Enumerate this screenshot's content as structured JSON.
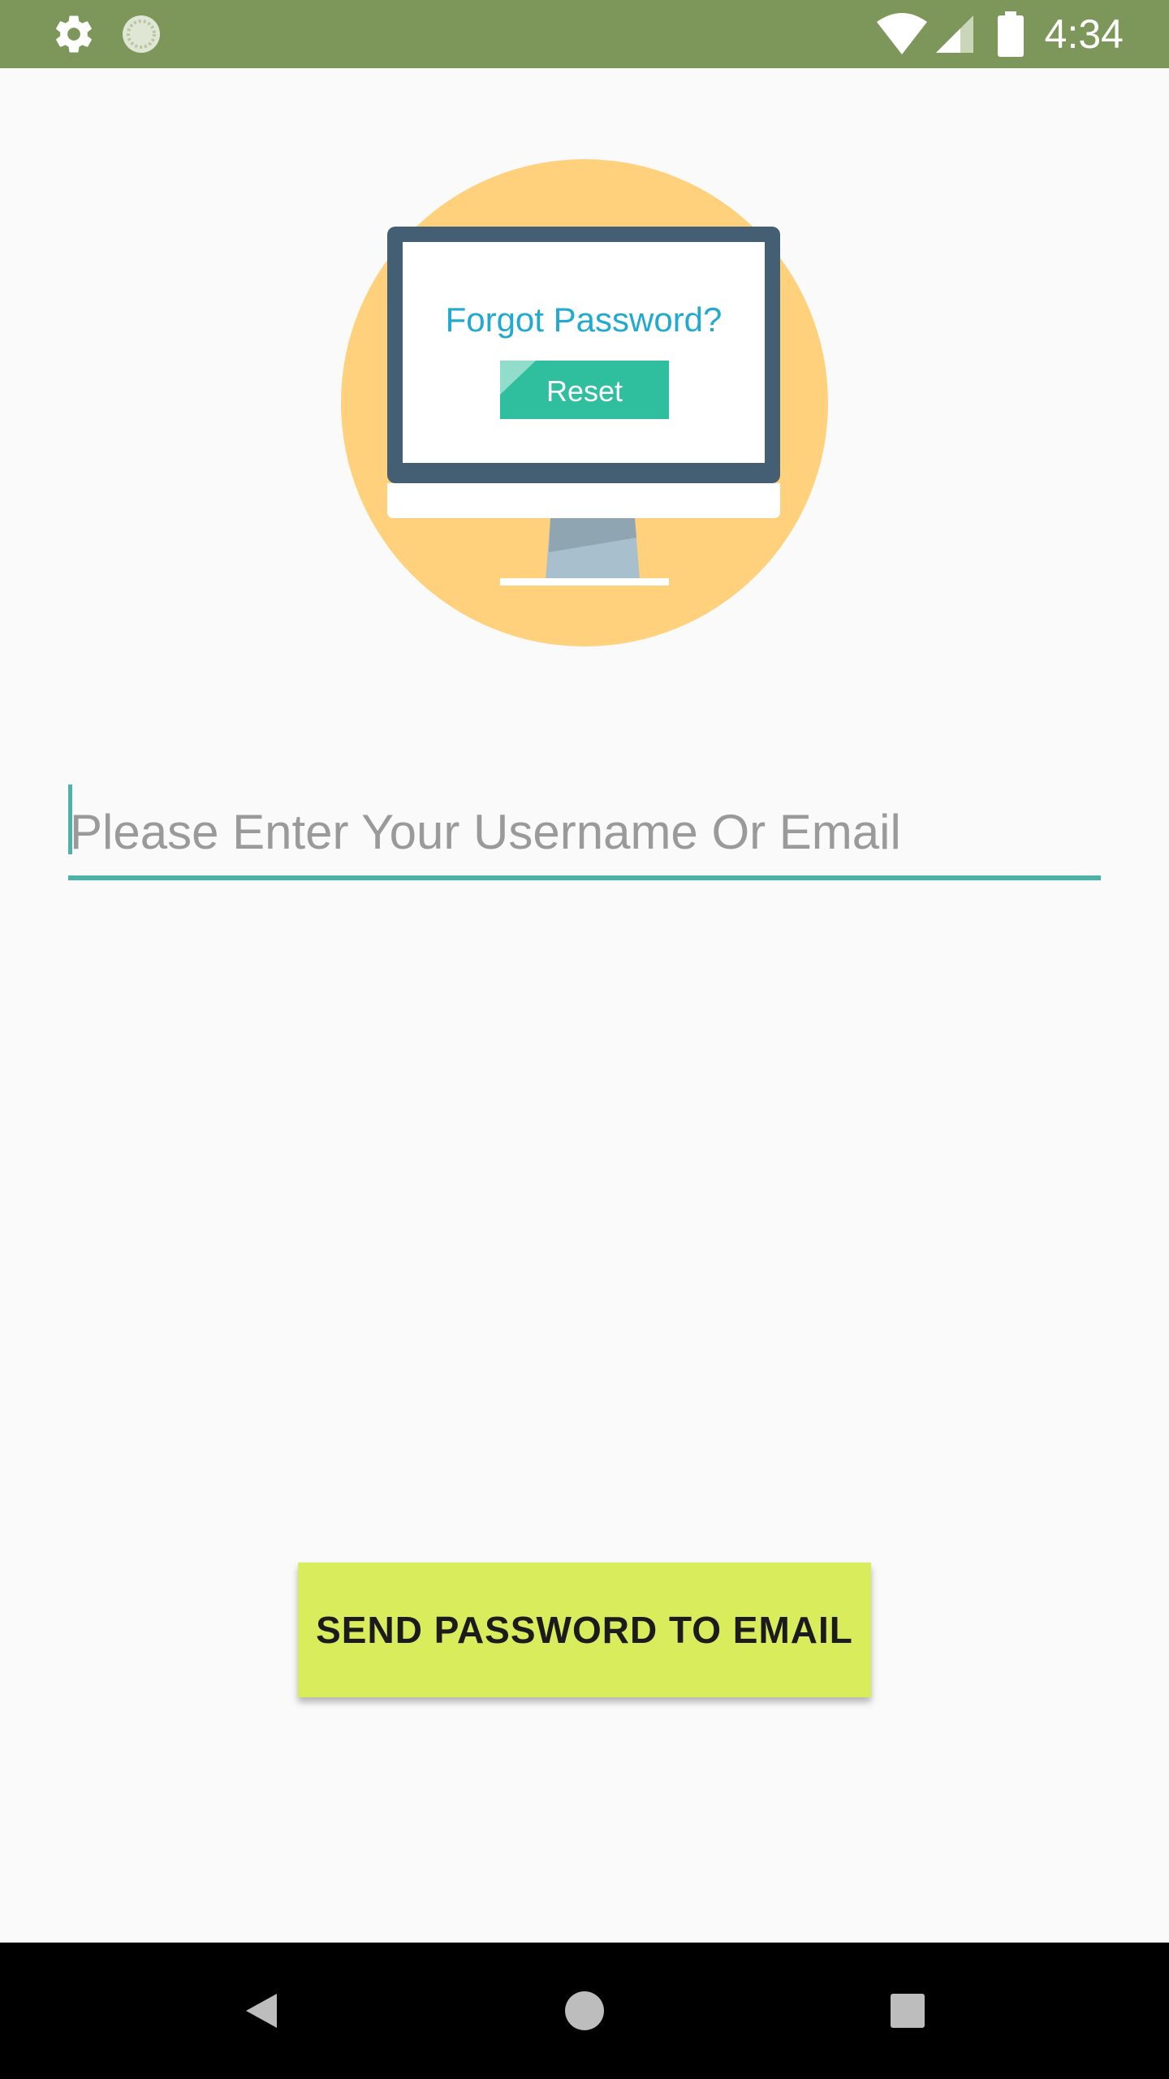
{
  "status_bar": {
    "time": "4:34",
    "left_icons": [
      "gear-icon",
      "loading-icon"
    ],
    "right_icons": [
      "wifi-icon",
      "signal-icon",
      "battery-icon"
    ]
  },
  "illustration": {
    "heading": "Forgot Password?",
    "button_label": "Reset"
  },
  "form": {
    "input_placeholder": "Please Enter Your Username Or Email",
    "input_value": ""
  },
  "actions": {
    "send_label": "SEND PASSWORD TO EMAIL"
  },
  "nav_bar": {
    "buttons": [
      "back-icon",
      "home-icon",
      "recents-icon"
    ]
  },
  "colors": {
    "status_bar": "#7c9759",
    "accent": "#4fb2a8",
    "button": "#d9ed5c",
    "circle": "#ffd17d",
    "monitor_frame": "#445f74",
    "reset_teal": "#2fbf9f",
    "heading_blue": "#22a9cf"
  }
}
